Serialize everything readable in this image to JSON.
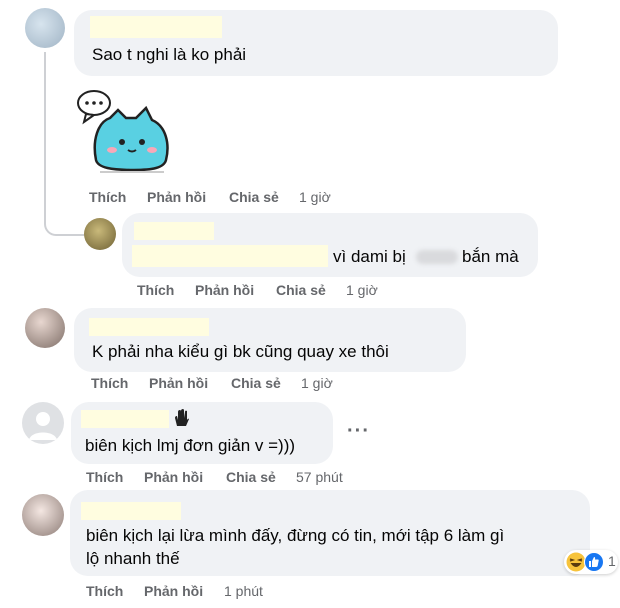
{
  "comments": [
    {
      "text": "Sao t nghi là ko phải",
      "sticker": "cat-blob-sticker",
      "actions": {
        "like": "Thích",
        "reply": "Phản hồi",
        "share": "Chia sẻ",
        "time": "1 giờ"
      }
    },
    {
      "text": "vì dami bị",
      "text_after": "bắn mà",
      "actions": {
        "like": "Thích",
        "reply": "Phản hồi",
        "share": "Chia sẻ",
        "time": "1 giờ"
      }
    },
    {
      "text": "K phải nha kiểu gì bk cũng quay xe thôi",
      "actions": {
        "like": "Thích",
        "reply": "Phản hồi",
        "share": "Chia sẻ",
        "time": "1 giờ"
      }
    },
    {
      "text": "biên kịch lmj đơn giản v =)))",
      "more": "···",
      "actions": {
        "like": "Thích",
        "reply": "Phản hồi",
        "share": "Chia sẻ",
        "time": "57 phút"
      }
    },
    {
      "line1": "biên kịch lại lừa mình đấy, đừng có tin, mới tập 6 làm gì",
      "line2": "lộ nhanh thế",
      "reaction_count": "1",
      "actions": {
        "like": "Thích",
        "reply": "Phản hồi",
        "time": "1 phút"
      }
    }
  ],
  "colors": {
    "bubble": "#f0f2f5",
    "meta": "#65676b",
    "like_blue": "#1877f2",
    "mask": "#fffde0"
  }
}
